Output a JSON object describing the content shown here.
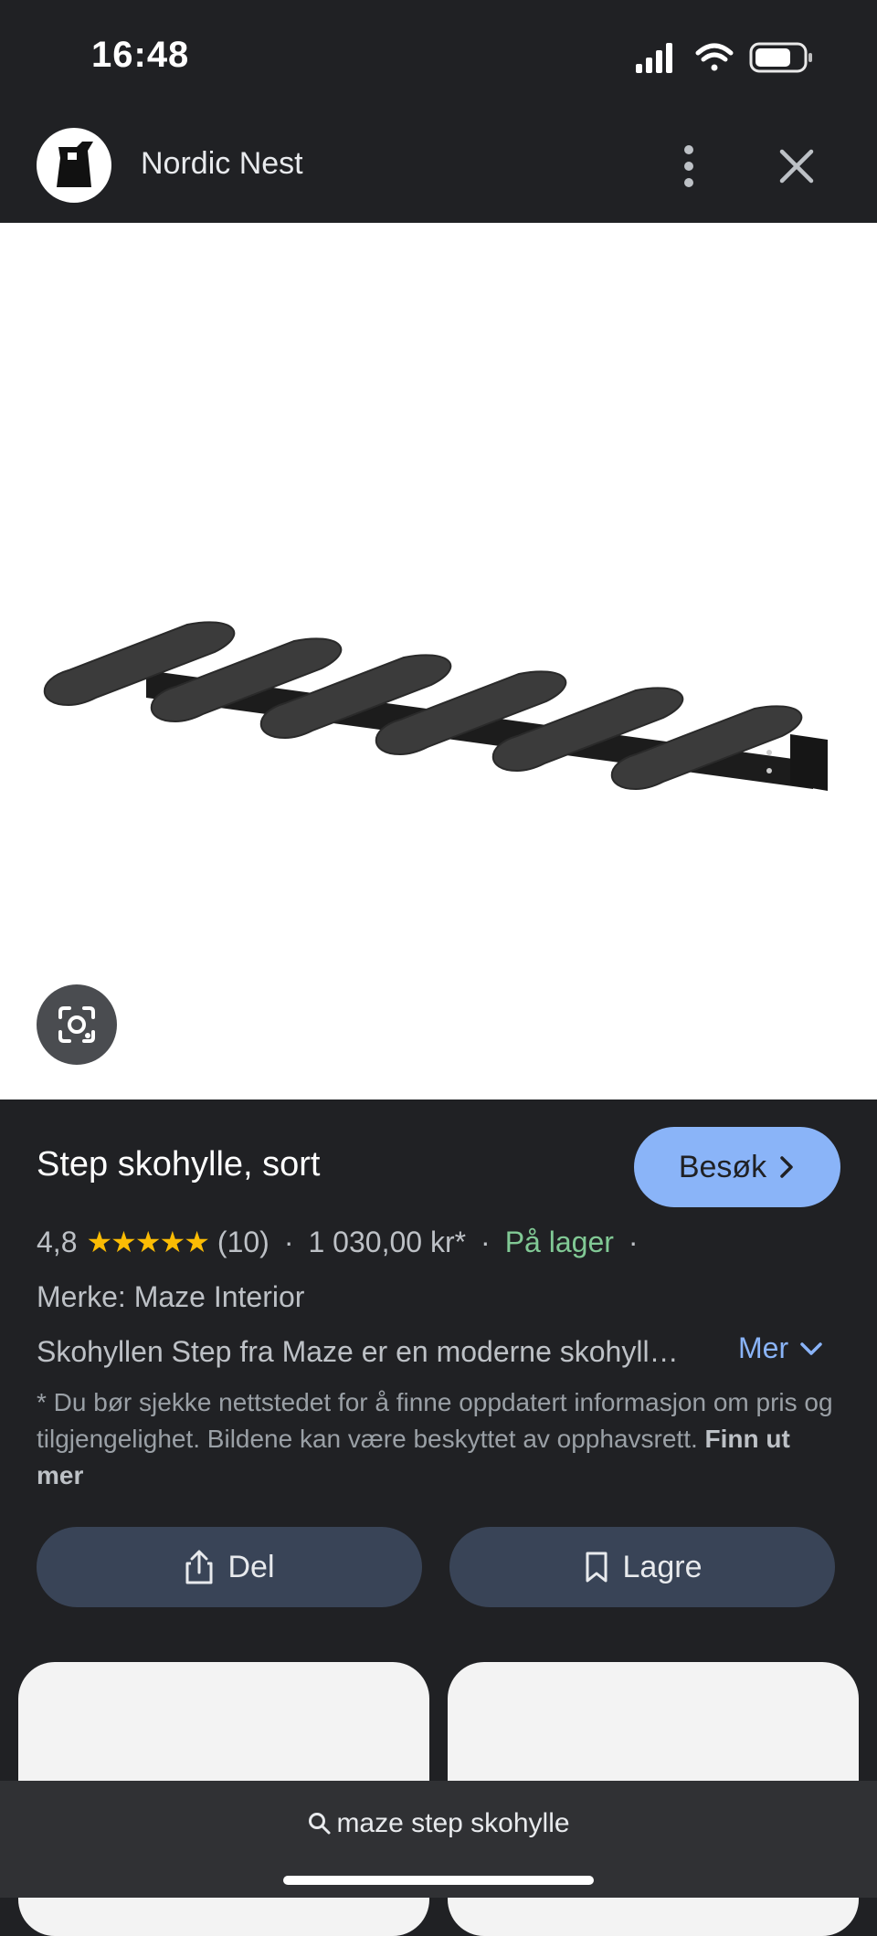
{
  "status_bar": {
    "time": "16:48"
  },
  "header": {
    "site_name": "Nordic Nest",
    "icons": [
      "more-vert-icon",
      "close-icon"
    ]
  },
  "product": {
    "title": "Step skohylle, sort",
    "visit_label": "Besøk",
    "rating": "4,8",
    "stars": "★★★★★",
    "review_count": "(10)",
    "separator": "·",
    "price": "1 030,00 kr*",
    "availability": "På lager",
    "brand": "Merke: Maze Interior",
    "description": "Skohyllen Step fra Maze er en moderne skohyll…",
    "more_label": "Mer",
    "disclaimer": "* Du bør sjekke nettstedet for å finne oppdatert informasjon om pris og tilgjengelighet. Bildene kan være beskyttet av opphavsrett.",
    "learn_more": "Finn ut mer"
  },
  "actions": {
    "share_label": "Del",
    "save_label": "Lagre"
  },
  "bottom": {
    "search_query": "maze step skohylle"
  },
  "colors": {
    "background": "#202124",
    "accent": "#8ab4f8",
    "in_stock": "#81c995",
    "stars": "#fbbc04",
    "action_button": "#394457"
  }
}
